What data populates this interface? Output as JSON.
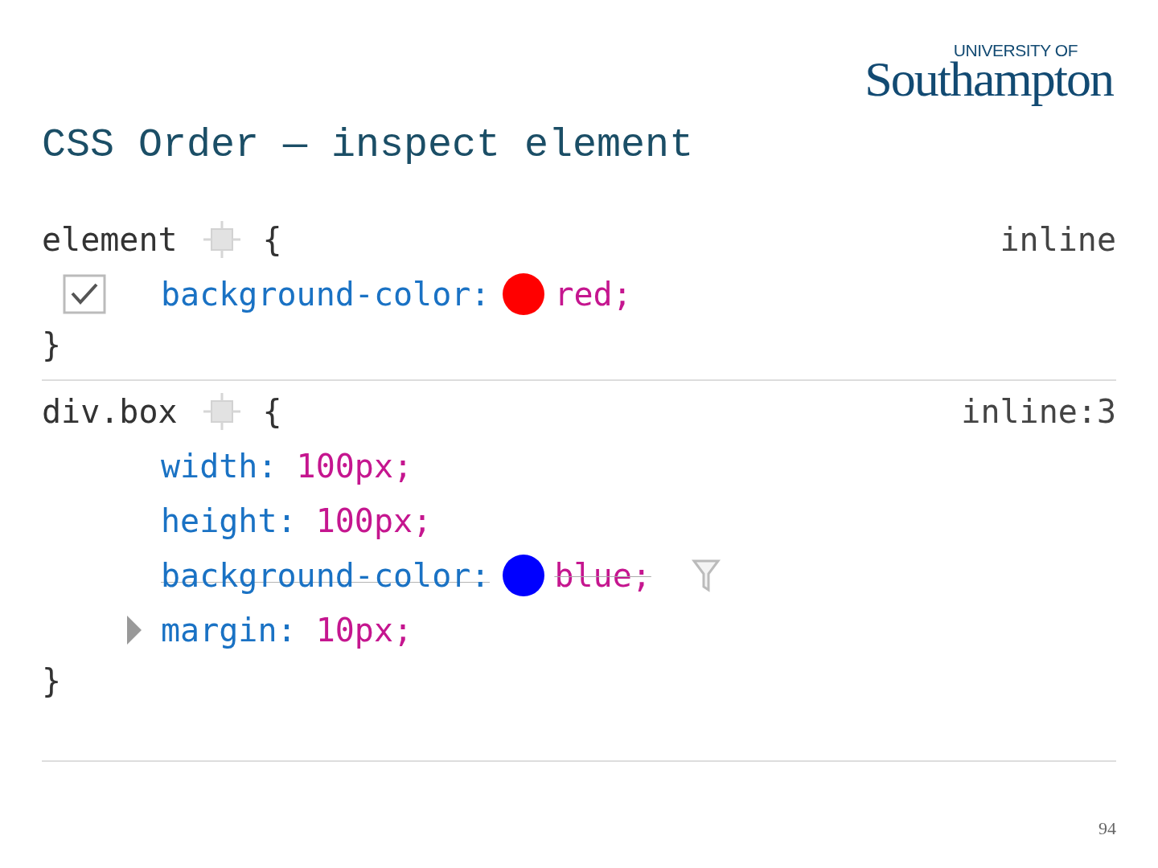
{
  "logo": {
    "line_1": "UNIVERSITY OF",
    "line_2": "Southampton"
  },
  "title": "CSS Order — inspect element",
  "rules": [
    {
      "selector": "element",
      "open": "{",
      "close": "}",
      "source": "inline",
      "declarations": [
        {
          "kind": "toggle",
          "checked": true,
          "name": "background-color:",
          "value": "red;",
          "color": "#ff0000",
          "overridden": false,
          "expandable": false
        }
      ]
    },
    {
      "selector": "div.box",
      "open": "{",
      "close": "}",
      "source": "inline:3",
      "declarations": [
        {
          "kind": "plain",
          "name": "width:",
          "value": "100px;",
          "overridden": false,
          "expandable": false
        },
        {
          "kind": "plain",
          "name": "height:",
          "value": "100px;",
          "overridden": false,
          "expandable": false
        },
        {
          "kind": "plain",
          "name": "background-color:",
          "value": "blue;",
          "color": "#0000ff",
          "overridden": true,
          "expandable": false,
          "filter": true
        },
        {
          "kind": "plain",
          "name": "margin:",
          "value": "10px;",
          "overridden": false,
          "expandable": true
        }
      ]
    }
  ],
  "page_number": "94"
}
